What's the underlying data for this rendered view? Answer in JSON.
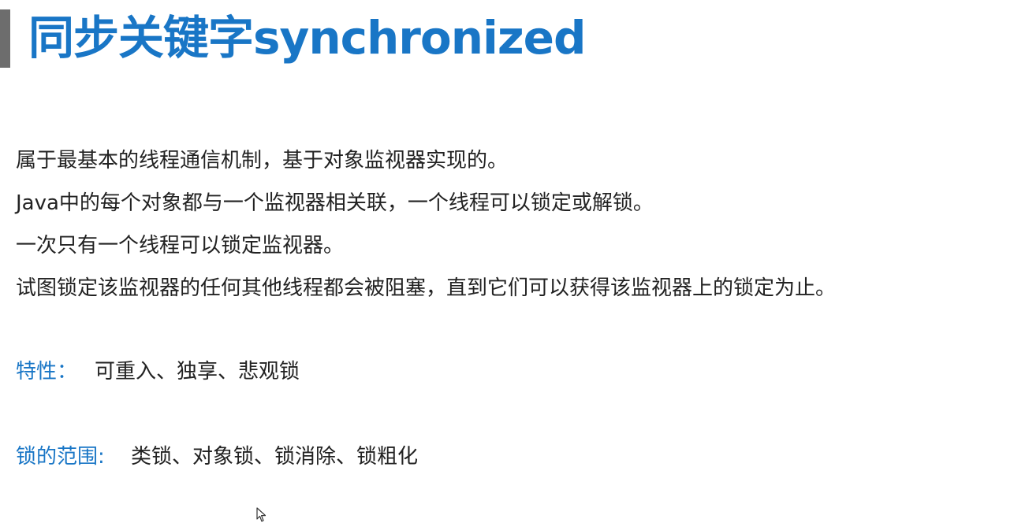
{
  "slide": {
    "title": "同步关键字synchronized",
    "paragraphs": [
      "属于最基本的线程通信机制，基于对象监视器实现的。",
      "Java中的每个对象都与一个监视器相关联，一个线程可以锁定或解锁。",
      "一次只有一个线程可以锁定监视器。",
      "试图锁定该监视器的任何其他线程都会被阻塞，直到它们可以获得该监视器上的锁定为止。"
    ],
    "features": {
      "label": "特性：",
      "value": "可重入、独享、悲观锁"
    },
    "lock_scope": {
      "label": "锁的范围:",
      "value": "类锁、对象锁、锁消除、锁粗化"
    }
  },
  "colors": {
    "accent": "#1976c6",
    "text": "#222222",
    "title_marker": "#6d6d6d",
    "background": "#ffffff"
  },
  "icons": {
    "cursor": "mouse-pointer-icon"
  }
}
